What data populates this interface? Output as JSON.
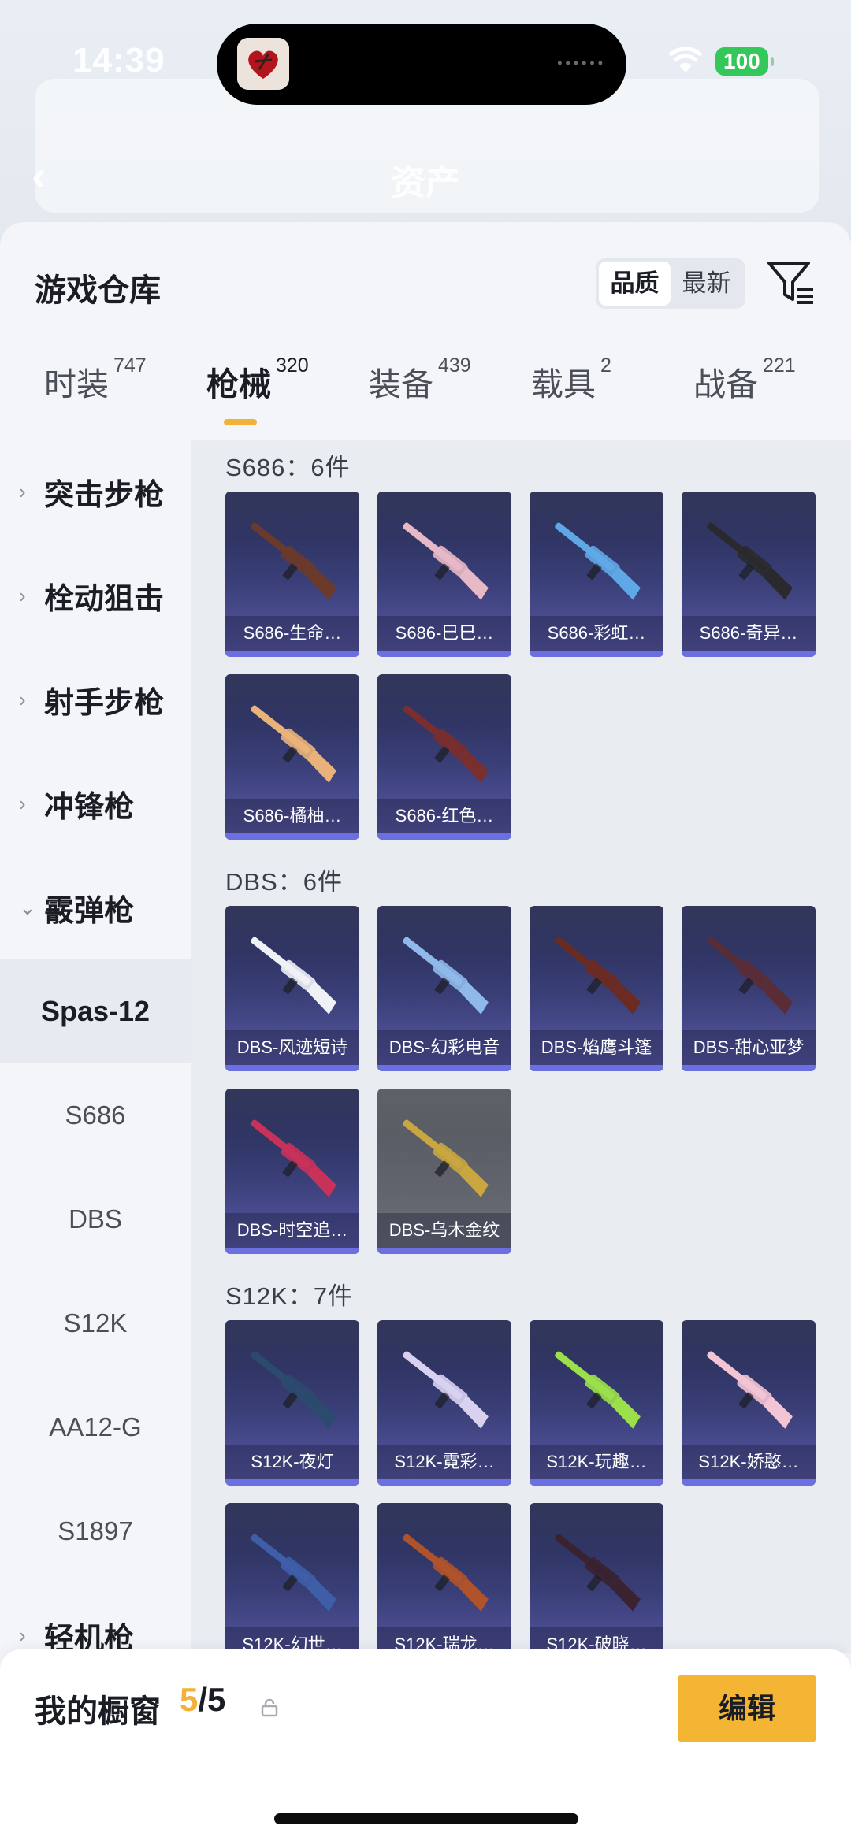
{
  "status_bar": {
    "time": "14:39",
    "battery": "100"
  },
  "background_page": {
    "title": "资产"
  },
  "sheet": {
    "title": "游戏仓库",
    "sort_options": [
      "品质",
      "最新"
    ],
    "sort_selected": "品质",
    "filter_icon": "filter-icon"
  },
  "tabs": [
    {
      "label": "时装",
      "count": "747"
    },
    {
      "label": "枪械",
      "count": "320",
      "active": true
    },
    {
      "label": "装备",
      "count": "439"
    },
    {
      "label": "载具",
      "count": "2"
    },
    {
      "label": "战备",
      "count": "221"
    }
  ],
  "sidenav": [
    {
      "label": "突击步枪",
      "type": "category"
    },
    {
      "label": "栓动狙击",
      "type": "category"
    },
    {
      "label": "射手步枪",
      "type": "category"
    },
    {
      "label": "冲锋枪",
      "type": "category"
    },
    {
      "label": "霰弹枪",
      "type": "category",
      "expanded": true
    },
    {
      "label": "Spas-12",
      "type": "sub",
      "selected": true
    },
    {
      "label": "S686",
      "type": "sub"
    },
    {
      "label": "DBS",
      "type": "sub"
    },
    {
      "label": "S12K",
      "type": "sub"
    },
    {
      "label": "AA12-G",
      "type": "sub"
    },
    {
      "label": "S1897",
      "type": "sub"
    },
    {
      "label": "轻机枪",
      "type": "category"
    }
  ],
  "groups": [
    {
      "title": "S686：6件",
      "items": [
        {
          "name": "S686-生命…",
          "color": "#6b3a2a"
        },
        {
          "name": "S686-巳巳…",
          "color": "#e7b8c6"
        },
        {
          "name": "S686-彩虹…",
          "color": "#5fa8e6"
        },
        {
          "name": "S686-奇异…",
          "color": "#2a2a2e"
        },
        {
          "name": "S686-橘柚…",
          "color": "#e9b27a"
        },
        {
          "name": "S686-红色…",
          "color": "#7a2e2e"
        }
      ]
    },
    {
      "title": "DBS：6件",
      "items": [
        {
          "name": "DBS-风迹短诗",
          "color": "#eef1f6"
        },
        {
          "name": "DBS-幻彩电音",
          "color": "#8fb9ea"
        },
        {
          "name": "DBS-焰鹰斗篷",
          "color": "#6b2a22"
        },
        {
          "name": "DBS-甜心亚梦",
          "color": "#5a2d36"
        },
        {
          "name": "DBS-时空追…",
          "color": "#c8325a"
        },
        {
          "name": "DBS-乌木金纹",
          "color": "#c9a640",
          "gray": true
        }
      ]
    },
    {
      "title": "S12K：7件",
      "items": [
        {
          "name": "S12K-夜灯",
          "color": "#2c4a6e"
        },
        {
          "name": "S12K-霓彩…",
          "color": "#d8d2f0"
        },
        {
          "name": "S12K-玩趣…",
          "color": "#9be04a"
        },
        {
          "name": "S12K-娇憨…",
          "color": "#f2c4d4"
        },
        {
          "name": "S12K-幻世…",
          "color": "#3e5ea8"
        },
        {
          "name": "S12K-瑞龙…",
          "color": "#b0532a"
        },
        {
          "name": "S12K-破晓…",
          "color": "#3a2230"
        }
      ]
    }
  ],
  "showcase": {
    "title": "我的橱窗",
    "current": "5",
    "total": "/5",
    "edit_label": "编辑"
  }
}
